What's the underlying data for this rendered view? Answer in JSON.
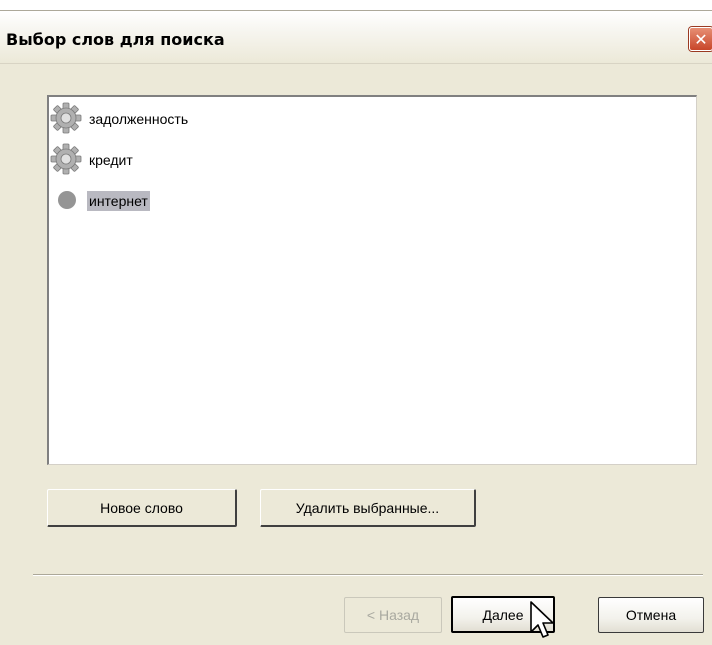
{
  "dialog": {
    "title": "Выбор слов для поиска",
    "close_label": "✕"
  },
  "word_list": {
    "items": [
      {
        "label": "задолженность",
        "icon": "gear-icon",
        "selected": false
      },
      {
        "label": "кредит",
        "icon": "gear-icon",
        "selected": false
      },
      {
        "label": "интернет",
        "icon": "gray-circle-icon",
        "selected": true
      }
    ]
  },
  "actions": {
    "new_word_label": "Новое слово",
    "delete_selected_label": "Удалить выбранные..."
  },
  "footer": {
    "back_label": "< Назад",
    "next_label": "Далее",
    "cancel_label": "Отмена"
  },
  "colors": {
    "dialog_bg": "#ece9d8",
    "selection_bg": "#b9b9c1",
    "close_button": "#c8462a"
  }
}
